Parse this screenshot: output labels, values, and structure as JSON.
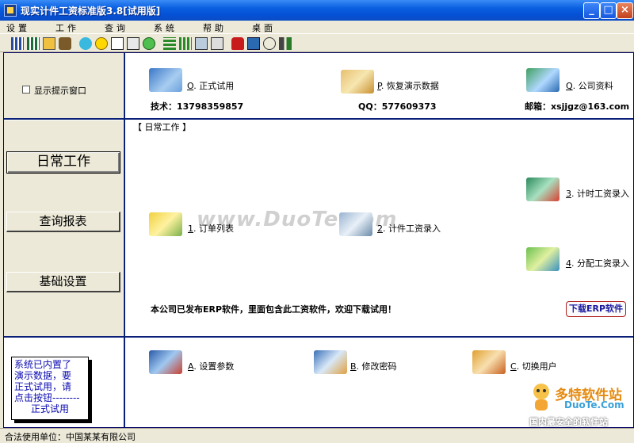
{
  "window": {
    "title": "现实计件工资标准版3.8[试用版]",
    "controls": {
      "minimize": "_",
      "maximize": "□",
      "close": "×"
    }
  },
  "menu": [
    "设置",
    "工作",
    "查询",
    "系统",
    "帮助",
    "桌面"
  ],
  "top_panel": {
    "checkbox_label": "显示提示窗口",
    "links": [
      {
        "key": "O",
        "label": "正式试用",
        "icon": "computer-icon"
      },
      {
        "key": "P",
        "label": "恢复演示数据",
        "icon": "restore-data-icon"
      },
      {
        "key": "Q",
        "label": "公司资料",
        "icon": "company-icon"
      }
    ],
    "contacts": {
      "tech": "技术：13798359857",
      "qq": "QQ：577609373",
      "email": "邮箱：xsjjgz@163.com"
    }
  },
  "nav": {
    "daily": "日常工作",
    "query": "查询报表",
    "base": "基础设置"
  },
  "main": {
    "section_label": "【 日常工作 】",
    "items": [
      {
        "key": "1",
        "label": "订单列表",
        "icon": "order-list-icon"
      },
      {
        "key": "2",
        "label": "计件工资录入",
        "icon": "piece-wage-icon"
      },
      {
        "key": "3",
        "label": "计时工资录入",
        "icon": "time-wage-icon"
      },
      {
        "key": "4",
        "label": "分配工资录入",
        "icon": "allocate-wage-icon"
      }
    ],
    "promo": "本公司已发布ERP软件，里面包含此工资软件，欢迎下载试用！",
    "download_button": "下载ERP软件"
  },
  "bottom_panel": {
    "tip_lines": [
      "系统已内置了",
      "演示数据，要",
      "正式试用，请",
      "点击按钮--------"
    ],
    "tip_button": "正式试用",
    "items": [
      {
        "key": "A",
        "label": "设置参数",
        "icon": "settings-icon"
      },
      {
        "key": "B",
        "label": "修改密码",
        "icon": "password-icon"
      },
      {
        "key": "C",
        "label": "切换用户",
        "icon": "switch-user-icon"
      }
    ]
  },
  "status": "合法使用单位：中国某某有限公司",
  "watermark": "www.DuoTe.com",
  "logo": {
    "brand": "多特软件站",
    "site": "DuoTe.Com",
    "slogan": "国内最安全的软件站"
  },
  "colors": {
    "titlebar": "#0a5fe0",
    "frame_line": "#0a1f78",
    "panel_bg": "#ece9d8",
    "tip_text": "#0a0ab0"
  }
}
